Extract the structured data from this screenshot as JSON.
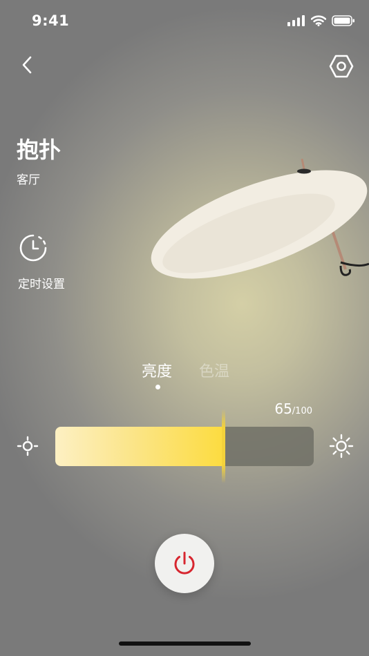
{
  "status_bar": {
    "time": "9:41",
    "icons": [
      "cellular-signal-icon",
      "wifi-icon",
      "battery-icon"
    ]
  },
  "header": {
    "back_icon": "chevron-left-icon",
    "settings_icon": "hexagon-settings-icon"
  },
  "device": {
    "name": "抱扑",
    "room": "客厅"
  },
  "timer": {
    "icon": "clock-icon",
    "label": "定时设置"
  },
  "tabs": [
    {
      "label": "亮度",
      "active": true
    },
    {
      "label": "色温",
      "active": false
    }
  ],
  "brightness": {
    "value": "65",
    "max": "/100",
    "level": 0.65,
    "low_icon": "sun-small-icon",
    "high_icon": "sun-large-icon"
  },
  "power": {
    "icon": "power-icon",
    "color": "#d7262f"
  },
  "colors": {
    "accent": "#fcdc40",
    "fill_start": "#fdf0c3"
  }
}
